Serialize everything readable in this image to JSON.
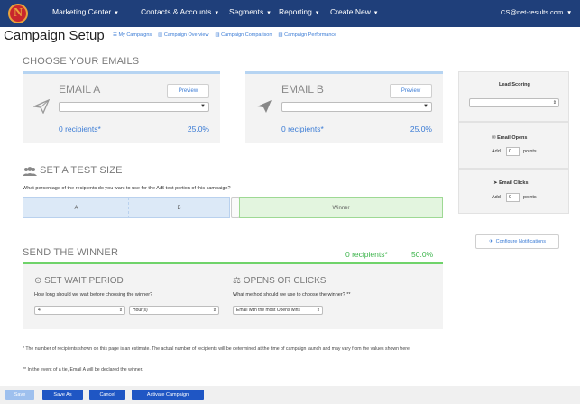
{
  "nav": {
    "logo": "N",
    "items": [
      "Marketing Center",
      "Contacts & Accounts",
      "Segments",
      "Reporting",
      "Create New"
    ],
    "user": "CS@net-results.com"
  },
  "page": {
    "title": "Campaign Setup",
    "subnav": [
      "My Campaigns",
      "Campaign Overview",
      "Campaign Comparison",
      "Campaign Performance"
    ]
  },
  "choose": {
    "title": "CHOOSE YOUR EMAILS",
    "emails": [
      {
        "label": "EMAIL A",
        "preview": "Preview",
        "recipients": "0 recipients*",
        "percent": "25.0%"
      },
      {
        "label": "EMAIL B",
        "preview": "Preview",
        "recipients": "0 recipients*",
        "percent": "25.0%"
      }
    ]
  },
  "test": {
    "title": "SET A TEST SIZE",
    "question": "What percentage of the recipients do you want to use for the A/B test portion of this campaign?",
    "seg_a": "A",
    "seg_b": "B",
    "seg_winner": "Winner"
  },
  "winner": {
    "title": "SEND THE WINNER",
    "recipients": "0 recipients*",
    "percent": "50.0%",
    "wait": {
      "title": "SET WAIT PERIOD",
      "question": "How long should we wait before choosing the winner?",
      "amount": "4",
      "unit": "Hour(s)"
    },
    "opens": {
      "title": "OPENS OR CLICKS",
      "question": "What method should we use to choose the winner? **",
      "method": "Email with the most Opens wins"
    }
  },
  "footnotes": [
    "* The number of recipients shown on this page is an estimate. The actual number of recipients will be determined at the time of campaign launch and may vary from the values shown here.",
    "** In the event of a tie, Email A will be declared the winner."
  ],
  "buttons": {
    "save": "Save",
    "save_as": "Save As",
    "cancel": "Cancel",
    "activate": "Activate Campaign"
  },
  "sidebar": {
    "lead_scoring": "Lead Scoring",
    "email_opens": "Email Opens",
    "email_clicks": "Email Clicks",
    "add": "Add",
    "points": "points",
    "opens_value": "0",
    "clicks_value": "0",
    "configure": "Configure Notifications"
  }
}
